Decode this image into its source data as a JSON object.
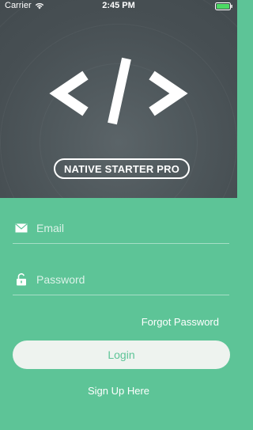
{
  "status_bar": {
    "carrier": "Carrier",
    "time": "2:45 PM",
    "battery_color": "#4cd964"
  },
  "header": {
    "logo_icon": "code-brackets-icon",
    "badge_text": "NATIVE STARTER PRO"
  },
  "form": {
    "email": {
      "placeholder": "Email",
      "value": "",
      "icon": "envelope-icon"
    },
    "password": {
      "placeholder": "Password",
      "value": "",
      "icon": "unlocked-padlock-icon"
    },
    "forgot_label": "Forgot Password",
    "login_label": "Login",
    "signup_label": "Sign Up Here"
  },
  "colors": {
    "accent_green": "#5dc497",
    "header_dark": "#474f53",
    "button_bg": "#eef3ef"
  }
}
